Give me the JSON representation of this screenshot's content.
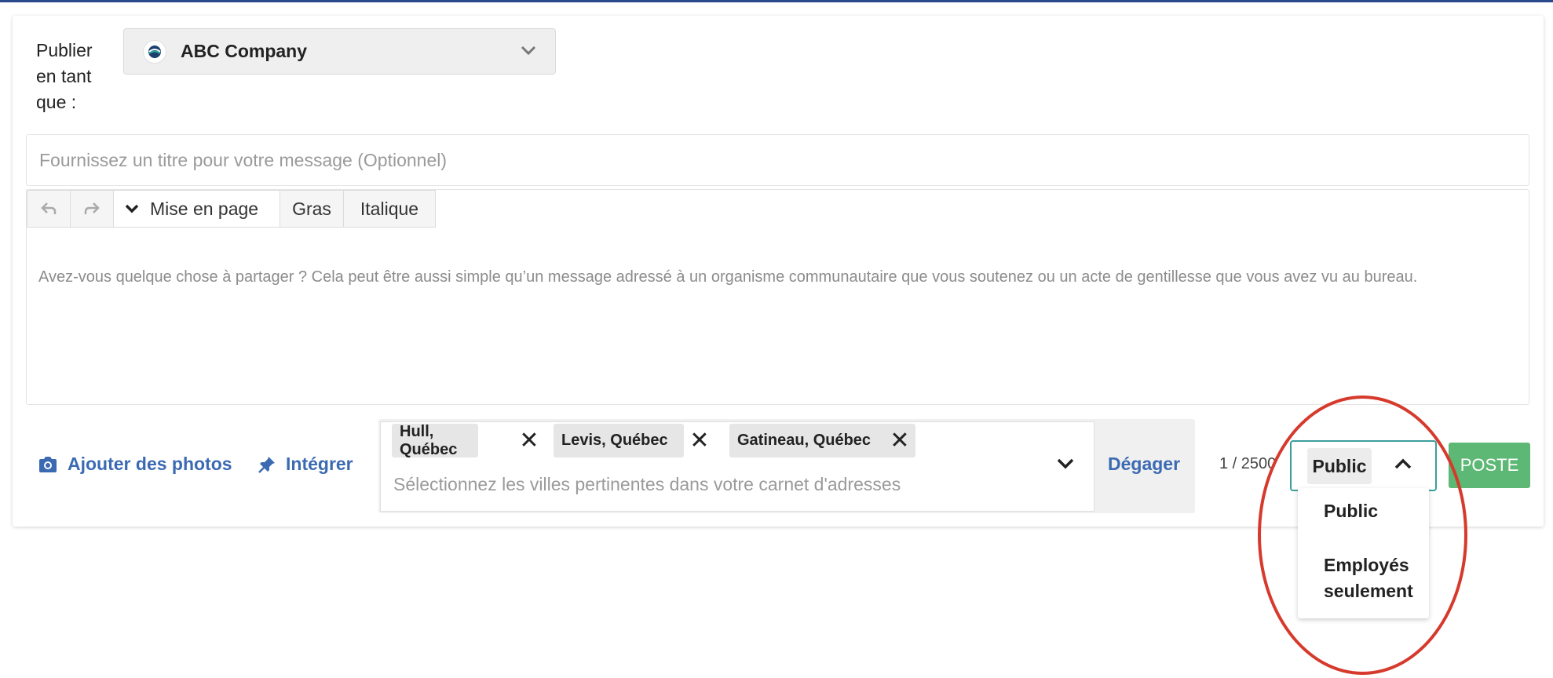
{
  "publish_as": {
    "label": "Publier en tant que :",
    "account": "ABC Company"
  },
  "title_input": {
    "placeholder": "Fournissez un titre pour votre message (Optionnel)"
  },
  "toolbar": {
    "format_label": "Mise en page",
    "bold_label": "Gras",
    "italic_label": "Italique"
  },
  "editor": {
    "placeholder": "Avez-vous quelque chose à partager ? Cela peut être aussi simple qu’un message adressé à un organisme communautaire que vous soutenez ou un acte de gentillesse que vous avez vu au bureau."
  },
  "actions": {
    "add_photos": "Ajouter des photos",
    "embed": "Intégrer"
  },
  "cities": {
    "tags": [
      "Hull, Québec",
      "Levis, Québec",
      "Gatineau, Québec"
    ],
    "placeholder": "Sélectionnez les villes pertinentes dans votre carnet d'adresses",
    "clear_label": "Dégager"
  },
  "char_count": "1 / 2500",
  "visibility": {
    "selected": "Public",
    "options": [
      "Public",
      "Employés seulement"
    ]
  },
  "post_button": "POSTE",
  "colors": {
    "link": "#3b6ab3",
    "post_button": "#5cb874",
    "select_border": "#3a9e9e",
    "highlight": "#d63a2c"
  },
  "icons": {
    "camera": "camera-icon",
    "pin": "pin-icon",
    "undo": "undo-icon",
    "redo": "redo-icon",
    "chevron": "chevron-down-icon"
  }
}
